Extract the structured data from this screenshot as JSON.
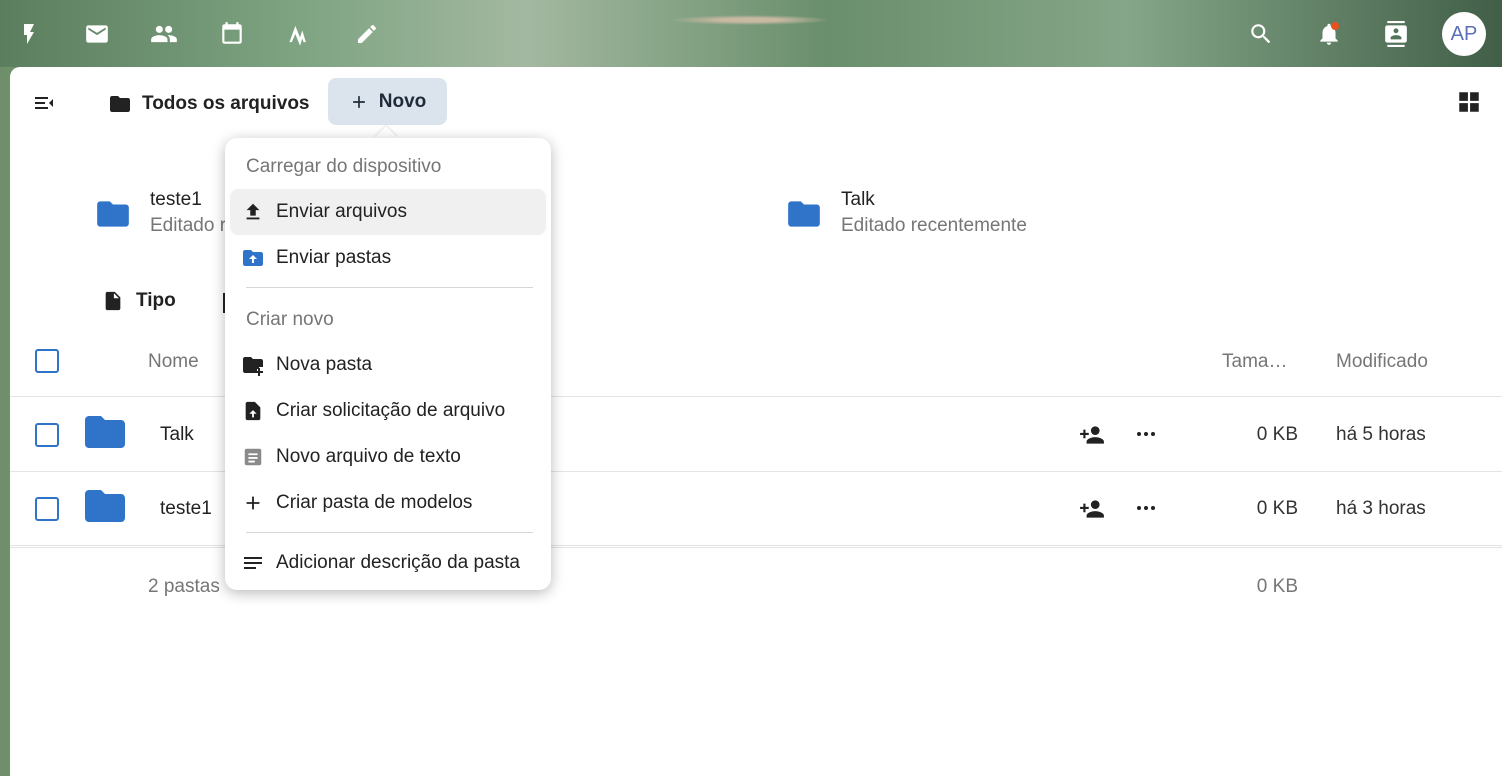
{
  "header": {
    "icons": [
      "activity-icon",
      "mail-icon",
      "contacts-icon",
      "calendar-icon",
      "notes-icon",
      "edit-icon"
    ],
    "right_icons": [
      "search-icon",
      "notifications-icon",
      "contacts-menu-icon"
    ],
    "avatar": "AP"
  },
  "breadcrumb": {
    "label": "Todos os arquivos",
    "new_button": "Novo"
  },
  "recent": [
    {
      "name": "teste1",
      "sub": "Editado r"
    },
    {
      "name": "Talk",
      "sub": "Editado recentemente"
    }
  ],
  "filters": {
    "type_label": "Tipo"
  },
  "table": {
    "columns": {
      "name": "Nome",
      "size": "Tama…",
      "modified": "Modificado"
    },
    "rows": [
      {
        "name": "Talk",
        "size": "0 KB",
        "modified": "há 5 horas"
      },
      {
        "name": "teste1",
        "size": "0 KB",
        "modified": "há 3 horas"
      }
    ],
    "footer": {
      "count": "2 pastas",
      "total": "0 KB"
    }
  },
  "menu": {
    "section_upload": "Carregar do dispositivo",
    "upload_files": "Enviar arquivos",
    "upload_folders": "Enviar pastas",
    "section_create": "Criar novo",
    "new_folder": "Nova pasta",
    "file_request": "Criar solicitação de arquivo",
    "new_text_file": "Novo arquivo de texto",
    "templates_folder": "Criar pasta de modelos",
    "add_description": "Adicionar descrição da pasta"
  },
  "colors": {
    "accent": "#2f74c8",
    "folder": "#2f74c8",
    "new_button_bg": "#dbe3ec",
    "notification_dot": "#e9521e"
  }
}
